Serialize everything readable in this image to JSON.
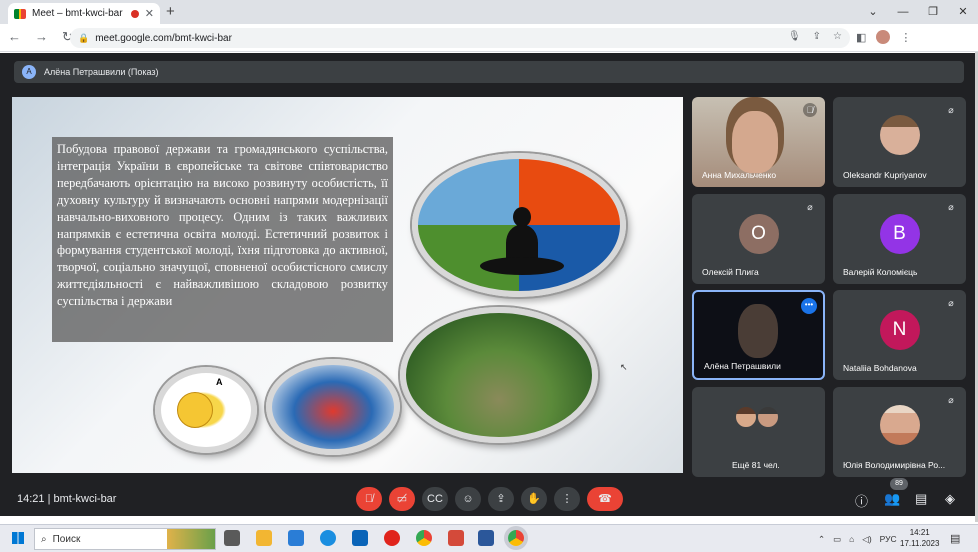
{
  "browser": {
    "tab_title": "Meet – bmt-kwci-bar",
    "url": "meet.google.com/bmt-kwci-bar"
  },
  "meet": {
    "presenter_initial": "A",
    "presenter_label": "Алёна Петрашвили (Показ)",
    "slide_text": "Побудова правової держави та громадянського суспільства, інтеграція України в європейське та світове співтовариство передбачають орієнтацію на високо розвинуту особистість, її духовну культуру й визначають основні напрями модернізації навчально-виховного процесу. Одним із таких важливих напрямків є естетична освіта молоді. Естетичний розвиток і формування студентської молоді, їхня підготовка до активної, творчої, соціально значущої, сповненої особистісного смислу життєдіяльності є найважливішою складовою розвитку суспільства і держави",
    "slide_small_label": "A",
    "participants": [
      {
        "name": "Анна Михальченко",
        "type": "video"
      },
      {
        "name": "Oleksandr Kupriyanov",
        "type": "photo"
      },
      {
        "name": "Олексій Плига",
        "type": "initial",
        "initial": "О",
        "color": "#8d6e63"
      },
      {
        "name": "Валерій Коломієць",
        "type": "initial",
        "initial": "В",
        "color": "#9334e6"
      },
      {
        "name": "Алёна Петрашвили",
        "type": "video"
      },
      {
        "name": "Nataliia Bohdanova",
        "type": "initial",
        "initial": "N",
        "color": "#c2185b"
      },
      {
        "name": "Ещё 81 чел.",
        "type": "more"
      },
      {
        "name": "Юлія Володимирівна Ро...",
        "type": "photo"
      }
    ],
    "time": "14:21",
    "meeting_code": "bmt-kwci-bar",
    "participant_count": "89"
  },
  "taskbar": {
    "search_placeholder": "Поиск",
    "language": "РУС",
    "time": "14:21",
    "date": "17.11.2023"
  }
}
